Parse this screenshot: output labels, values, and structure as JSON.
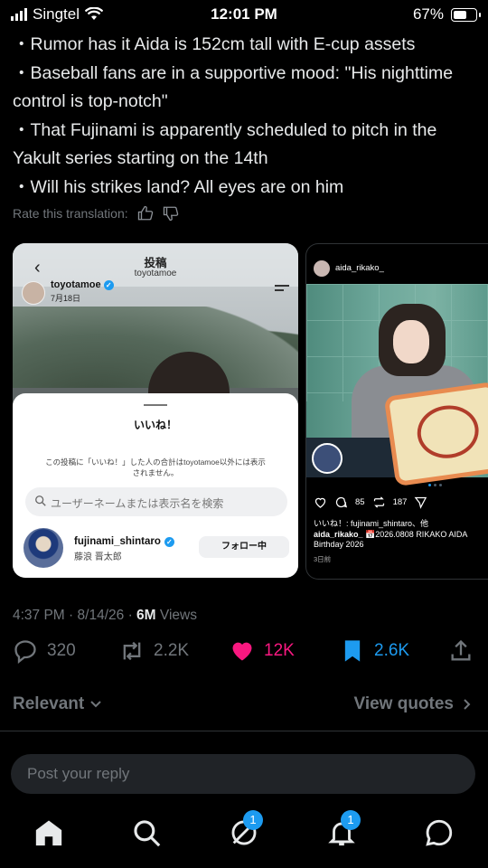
{
  "status_bar": {
    "carrier": "Singtel",
    "time": "12:01 PM",
    "battery": "67%",
    "battery_level": 0.67
  },
  "tweet": {
    "lines": [
      "・Rumor has it Aida is 152cm tall with E-cup assets",
      "・Baseball fans are in a supportive mood: \"His nighttime control is top-notch\"",
      "・That Fujinami is apparently scheduled to pitch in the Yakult series starting on the 14th",
      "・Will his strikes land? All eyes are on him"
    ],
    "rate_translation": "Rate this translation:"
  },
  "media1": {
    "header_title": "投稿",
    "header_sub": "toyotamoe",
    "post_user": "toyotamoe",
    "post_date": "7月18日",
    "sheet_title": "いいね！",
    "sheet_desc": "この投稿に「いいね！」した人の合計はtoyotamoe以外には表示されません。",
    "search_placeholder": "ユーザーネームまたは表示名を検索",
    "follower_name": "fujinami_shintaro",
    "follower_sub": "藤浪 晋太郎",
    "follow_button": "フォロー中"
  },
  "media2": {
    "username": "aida_rikako_",
    "comments": "85",
    "reposts": "187",
    "likes_line": "いいね！: fujinami_shintaro、他",
    "caption_user": "aida_rikako_",
    "caption": "📅2026.0808 RIKAKO AIDA Birthday 2026",
    "ago": "3日前"
  },
  "meta": {
    "time": "4:37 PM",
    "sep1": "·",
    "date": "8/14/26",
    "sep2": "·",
    "views_count": "6M",
    "views_label": "Views"
  },
  "stats": {
    "replies": "320",
    "reposts": "2.2K",
    "likes": "12K",
    "bookmarks": "2.6K"
  },
  "colors": {
    "like": "#f91880",
    "bookmark": "#1d9bf0",
    "muted": "#71767b"
  },
  "sort": {
    "label": "Relevant",
    "quotes": "View quotes"
  },
  "reply": {
    "placeholder": "Post your reply"
  },
  "nav": {
    "grok_badge": "1",
    "notif_badge": "1",
    "items": [
      "home-icon",
      "search-icon",
      "grok-icon",
      "bell-icon",
      "messages-icon"
    ]
  }
}
